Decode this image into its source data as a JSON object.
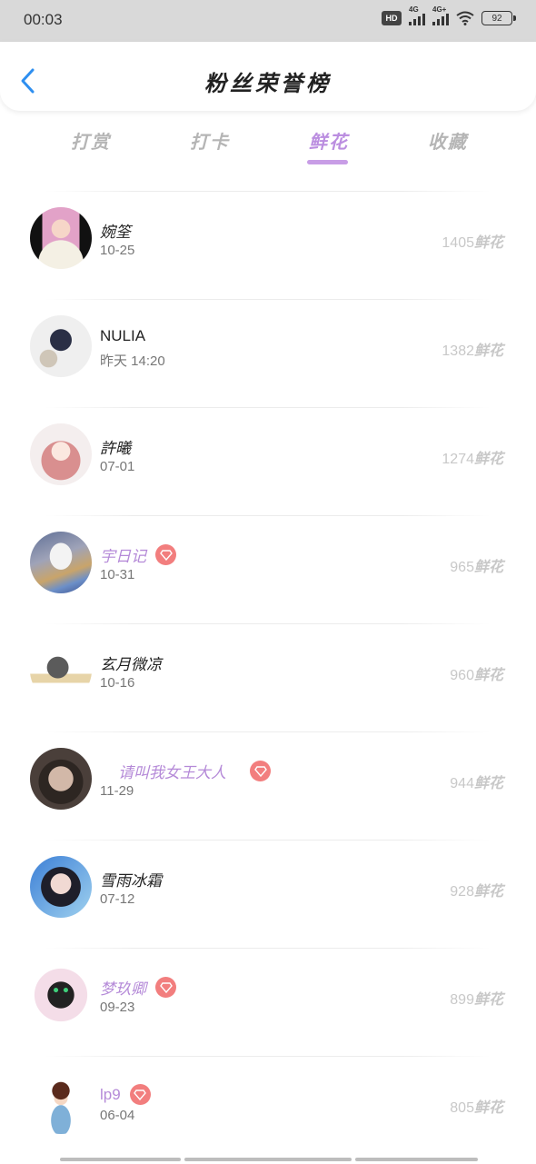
{
  "status": {
    "time": "00:03",
    "hd": "HD",
    "net1": "4G",
    "net2": "4G+",
    "battery": "92"
  },
  "header": {
    "title": "粉丝荣誉榜"
  },
  "tabs": [
    {
      "label": "打赏"
    },
    {
      "label": "打卡"
    },
    {
      "label": "鲜花",
      "active": true
    },
    {
      "label": "收藏"
    }
  ],
  "unit": "鲜花",
  "fans": [
    {
      "name": "婉筌",
      "date": "10-25",
      "count": "1405",
      "vip": false,
      "avatar": "photo-girl-icon"
    },
    {
      "name": "NULIA",
      "date": "昨天 14:20",
      "count": "1382",
      "vip": false,
      "avatar": "outfit-icon"
    },
    {
      "name": "許曦",
      "date": "07-01",
      "count": "1274",
      "vip": false,
      "avatar": "anime-girl-icon"
    },
    {
      "name": "宇日记",
      "date": "10-31",
      "count": "965",
      "vip": true,
      "avatar": "rainbow-cloud-icon"
    },
    {
      "name": "玄月微凉",
      "date": "10-16",
      "count": "960",
      "vip": false,
      "avatar": "cartoon-cat-icon"
    },
    {
      "name": "请叫我女王大人",
      "date": "11-29",
      "count": "944",
      "vip": true,
      "avatar": "glasses-girl-icon"
    },
    {
      "name": "雪雨冰霜",
      "date": "07-12",
      "count": "928",
      "vip": false,
      "avatar": "portrait-girl-icon"
    },
    {
      "name": "梦玖卿",
      "date": "09-23",
      "count": "899",
      "vip": true,
      "avatar": "black-cat-icon"
    },
    {
      "name": "lp9",
      "date": "06-04",
      "count": "805",
      "vip": true,
      "avatar": "chibi-boy-icon"
    }
  ],
  "colors": {
    "accent": "#bb8ee0",
    "vip_name": "#b58ad8",
    "gem": "#f27e7e",
    "count": "#c8c8c8"
  }
}
